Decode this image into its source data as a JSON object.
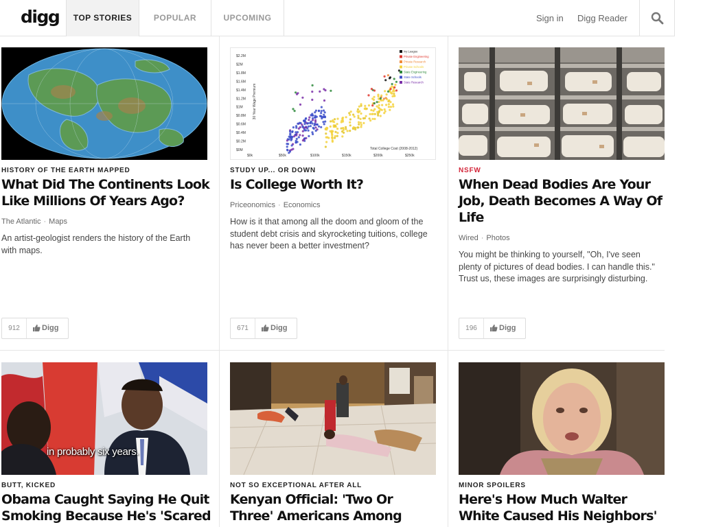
{
  "header": {
    "logo": "digg",
    "tabs": [
      {
        "label": "TOP STORIES",
        "active": true
      },
      {
        "label": "POPULAR",
        "active": false
      },
      {
        "label": "UPCOMING",
        "active": false
      }
    ],
    "sign_in": "Sign in",
    "reader": "Digg Reader",
    "search_icon": "search-icon"
  },
  "stories": [
    {
      "kicker": "HISTORY OF THE EARTH MAPPED",
      "title": "What Did The Continents Look Like Millions Of Years Ago?",
      "source": "The Atlantic",
      "category": "Maps",
      "description": "An artist-geologist renders the history of the Earth with maps.",
      "diggs": "912",
      "digg_label": "Digg",
      "image": "world-map-image"
    },
    {
      "kicker": "STUDY UP... OR DOWN",
      "title": "Is College Worth It?",
      "source": "Priceonomics",
      "category": "Economics",
      "description": "How is it that among all the doom and gloom of the student debt crisis and skyrocketing tuitions, college has never been a better investment?",
      "diggs": "671",
      "digg_label": "Digg",
      "image": "college-scatter-chart-image",
      "chart": {
        "y_ticks": [
          "$2.2M",
          "$2M",
          "$1.8M",
          "$1.6M",
          "$1.4M",
          "$1.2M",
          "$1M",
          "$0.8M",
          "$0.6M",
          "$0.4M",
          "$0.2M",
          "$0M"
        ],
        "x_ticks": [
          "$0k",
          "$50k",
          "$100k",
          "$150k",
          "$200k",
          "$250k"
        ],
        "y_label": "30 Year Wage Premium",
        "x_label": "Total College Cost (2008-2012)",
        "legend": [
          {
            "label": "Ivy League",
            "color": "#111111"
          },
          {
            "label": "Private Engineering",
            "color": "#e0372e"
          },
          {
            "label": "Private Research",
            "color": "#f08a3a"
          },
          {
            "label": "Private Schools",
            "color": "#f4d23d"
          },
          {
            "label": "State Engineering",
            "color": "#2f8a3c"
          },
          {
            "label": "State Schools",
            "color": "#3c4fc9"
          },
          {
            "label": "State Research",
            "color": "#7a2fa8"
          }
        ]
      }
    },
    {
      "kicker": "NSFW",
      "kicker_style": "nsfw",
      "title": "When Dead Bodies Are Your Job, Death Becomes A Way Of Life",
      "source": "Wired",
      "category": "Photos",
      "description": "You might be thinking to yourself, \"Oh, I've seen plenty of pictures of dead bodies. I can handle this.\" Trust us, these images are surprisingly disturbing.",
      "diggs": "196",
      "digg_label": "Digg",
      "image": "morgue-shelves-image"
    },
    {
      "kicker": "BUTT, KICKED",
      "title": "Obama Caught Saying He Quit Smoking Because He's 'Scared",
      "image": "obama-video-still-image",
      "caption": "in probably six years."
    },
    {
      "kicker": "NOT SO EXCEPTIONAL AFTER ALL",
      "title": "Kenyan Official: 'Two Or Three' Americans Among Gunmen",
      "image": "mall-attack-image"
    },
    {
      "kicker": "MINOR SPOILERS",
      "title": "Here's How Much Walter White Caused His Neighbors' Home",
      "image": "tv-still-woman-image"
    }
  ],
  "colors": {
    "nsfw": "#d3263a",
    "rule": "#e2e2e2",
    "active_tab_bg": "#f2f2f2"
  }
}
